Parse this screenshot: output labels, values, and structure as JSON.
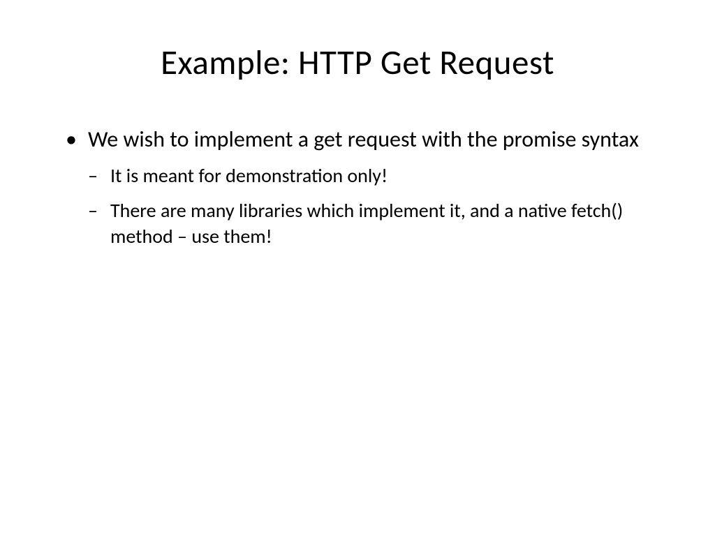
{
  "slide": {
    "title": "Example: HTTP Get Request",
    "bullets": [
      {
        "text": "We wish to implement a get request with the promise syntax",
        "subbullets": [
          "It is meant for demonstration only!",
          "There are many libraries which implement it, and a native fetch() method – use them!"
        ]
      }
    ]
  }
}
